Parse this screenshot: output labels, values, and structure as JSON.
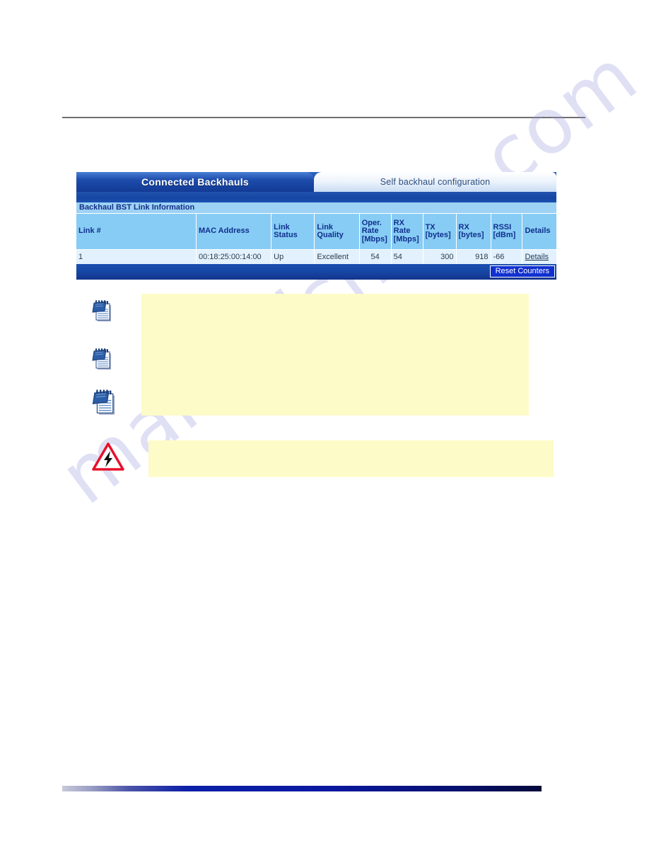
{
  "page": {
    "watermark": "manualshive.com"
  },
  "ui": {
    "tabs": [
      {
        "label": "Connected Backhauls",
        "active": true
      },
      {
        "label": "Self backhaul configuration",
        "active": false
      }
    ],
    "section_title": "Backhaul BST Link Information",
    "table": {
      "headers": [
        "Link #",
        "MAC Address",
        "Link Status",
        "Link Quality",
        "Oper. Rate [Mbps]",
        "RX Rate [Mbps]",
        "TX [bytes]",
        "RX [bytes]",
        "RSSI [dBm]",
        "Details"
      ],
      "header_lines": [
        [
          "Link #"
        ],
        [
          "MAC Address"
        ],
        [
          "Link",
          "Status"
        ],
        [
          "Link",
          "Quality"
        ],
        [
          "Oper.",
          "Rate",
          "[Mbps]"
        ],
        [
          "RX",
          "Rate",
          "[Mbps]"
        ],
        [
          "TX",
          "[bytes]"
        ],
        [
          "RX",
          "[bytes]"
        ],
        [
          "RSSI",
          "[dBm]"
        ],
        [
          "Details"
        ]
      ],
      "rows": [
        {
          "link_number": "1",
          "mac_address": "00:18:25:00:14:00",
          "link_status": "Up",
          "link_quality": "Excellent",
          "oper_rate_mbps": "54",
          "rx_rate_mbps": "54",
          "tx_bytes": "300",
          "rx_bytes": "918",
          "rssi_dbm": "-66",
          "details_link": "Details"
        }
      ]
    },
    "reset_button": "Reset Counters"
  },
  "notes": {
    "items": [
      {
        "icon": "note-icon",
        "text": ""
      },
      {
        "icon": "note-icon",
        "text": ""
      },
      {
        "icon": "note-icon",
        "text": ""
      }
    ],
    "warning": {
      "icon": "warning-triangle-icon",
      "text": ""
    }
  },
  "colors": {
    "tab_active_blue": "#1d4cab",
    "table_header_blue": "#87ccf5",
    "table_row_blue": "#e2f1fd",
    "section_title_blue": "#9ed2f5",
    "note_box_yellow": "#fdfbc8",
    "warning_red": "#e8102a",
    "footer_blue": "#0b1fa8",
    "rule_gray": "#6f6f6f"
  }
}
